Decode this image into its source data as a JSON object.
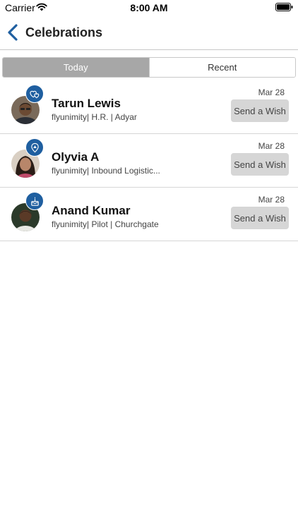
{
  "status_bar": {
    "carrier": "Carrier",
    "time": "8:00 AM",
    "wifi_icon": "wifi-icon",
    "battery_icon": "battery-icon"
  },
  "nav": {
    "title": "Celebrations",
    "back_icon": "chevron-left-icon"
  },
  "tabs": [
    {
      "label": "Today",
      "active": true
    },
    {
      "label": "Recent",
      "active": false
    }
  ],
  "celebrations": [
    {
      "name": "Tarun Lewis",
      "subtitle": "flyunimity| H.R. | Adyar",
      "date": "Mar 28",
      "action": "Send a Wish",
      "badge_icon": "anniversary-hearts-icon"
    },
    {
      "name": "Olyvia A",
      "subtitle": "flyunimity| Inbound Logistic...",
      "date": "Mar 28",
      "action": "Send a Wish",
      "badge_icon": "work-anniversary-icon"
    },
    {
      "name": "Anand Kumar",
      "subtitle": "flyunimity| Pilot | Churchgate",
      "date": "Mar 28",
      "action": "Send a Wish",
      "badge_icon": "birthday-cake-icon"
    }
  ],
  "colors": {
    "accent": "#1f5fa0",
    "segment_active": "#a7a7a7",
    "wish_button": "#d6d6d6"
  }
}
